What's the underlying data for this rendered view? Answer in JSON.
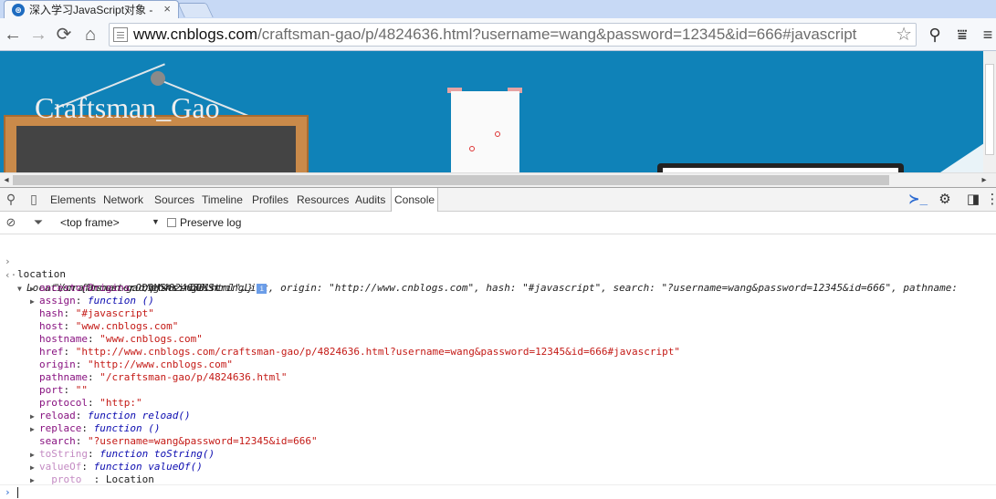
{
  "tab": {
    "title": "深入学习JavaScript对象 -",
    "close": "×",
    "favicon_text": "⊛"
  },
  "toolbar": {
    "back": "←",
    "forward": "→",
    "reload": "⟳",
    "home": "⌂",
    "url_host": "www.cnblogs.com",
    "url_rest": "/craftsman-gao/p/4824636.html?username=wang&password=12345&id=666#javascript",
    "star": "☆",
    "ext1": "⚲",
    "ext2": "⩸",
    "menu": "≡"
  },
  "page": {
    "banner_text": "Craftsman_Gao"
  },
  "hscroll": {
    "left": "◂",
    "right": "▸"
  },
  "devtools": {
    "tabs": [
      "Elements",
      "Network",
      "Sources",
      "Timeline",
      "Profiles",
      "Resources",
      "Audits",
      "Console"
    ],
    "selected_tab": "Console",
    "icons": {
      "search": "⚲",
      "device": "▯",
      "prompt": "≻_",
      "settings": "⚙",
      "dock": "◨",
      "more": "⋮"
    },
    "filter": {
      "clear": "⊘",
      "funnel": "⏷",
      "frame": "<top frame>",
      "frame_arrow": "▼",
      "preserve_log": "Preserve log"
    }
  },
  "console": {
    "input_cmd": "location",
    "summary_head": "Location {",
    "summary": [
      {
        "k": "ancestorOrigins",
        "v": "DOMStringList",
        "type": "plain"
      },
      {
        "k": "origin",
        "v": "\"http://www.cnblogs.com\"",
        "type": "s"
      },
      {
        "k": "hash",
        "v": "\"#javascript\"",
        "type": "s"
      },
      {
        "k": "search",
        "v": "\"?username=wang&password=12345&id=666\"",
        "type": "s"
      },
      {
        "k": "pathname",
        "v": "",
        "type": "s"
      }
    ],
    "summary_line2": "\"/craftsman-gao/p/4824636.html\"…}",
    "info": "i",
    "props": [
      {
        "tri": true,
        "k": "ancestorOrigins",
        "v": "DOMStringList",
        "type": "plain",
        "dim": false
      },
      {
        "tri": true,
        "k": "assign",
        "v": "function ()",
        "type": "fn",
        "dim": false
      },
      {
        "tri": false,
        "k": "hash",
        "v": "\"#javascript\"",
        "type": "s",
        "dim": false
      },
      {
        "tri": false,
        "k": "host",
        "v": "\"www.cnblogs.com\"",
        "type": "s",
        "dim": false
      },
      {
        "tri": false,
        "k": "hostname",
        "v": "\"www.cnblogs.com\"",
        "type": "s",
        "dim": false
      },
      {
        "tri": false,
        "k": "href",
        "v": "\"http://www.cnblogs.com/craftsman-gao/p/4824636.html?username=wang&password=12345&id=666#javascript\"",
        "type": "s",
        "dim": false
      },
      {
        "tri": false,
        "k": "origin",
        "v": "\"http://www.cnblogs.com\"",
        "type": "s",
        "dim": false
      },
      {
        "tri": false,
        "k": "pathname",
        "v": "\"/craftsman-gao/p/4824636.html\"",
        "type": "s",
        "dim": false
      },
      {
        "tri": false,
        "k": "port",
        "v": "\"\"",
        "type": "s",
        "dim": false
      },
      {
        "tri": false,
        "k": "protocol",
        "v": "\"http:\"",
        "type": "s",
        "dim": false
      },
      {
        "tri": true,
        "k": "reload",
        "v": "function reload()",
        "type": "fn",
        "dim": false
      },
      {
        "tri": true,
        "k": "replace",
        "v": "function ()",
        "type": "fn",
        "dim": false
      },
      {
        "tri": false,
        "k": "search",
        "v": "\"?username=wang&password=12345&id=666\"",
        "type": "s",
        "dim": false
      },
      {
        "tri": true,
        "k": "toString",
        "v": "function toString()",
        "type": "fn",
        "dim": true
      },
      {
        "tri": true,
        "k": "valueOf",
        "v": "function valueOf()",
        "type": "fn",
        "dim": true
      },
      {
        "tri": true,
        "k": "__proto__",
        "v": "Location",
        "type": "plain",
        "dim": true
      }
    ],
    "gutter_in": "›",
    "gutter_out": "‹·",
    "expand": "▼",
    "collapsed": "▶"
  }
}
